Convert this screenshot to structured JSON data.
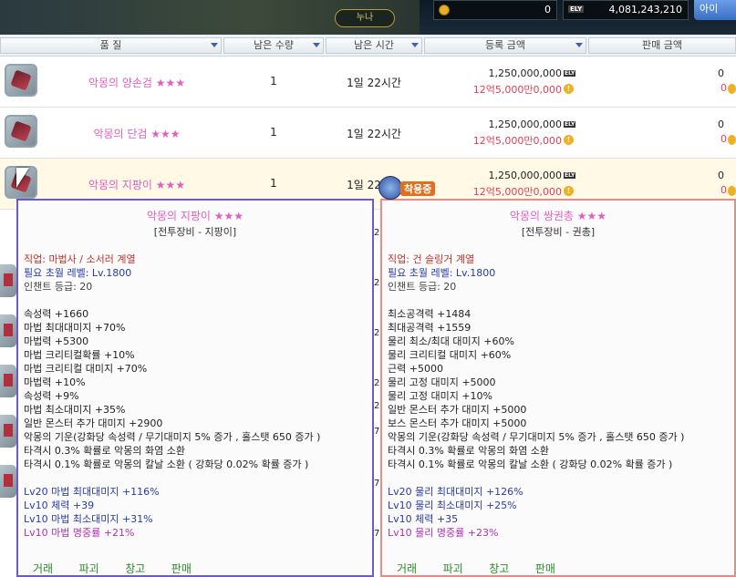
{
  "top": {
    "page_label": "누나",
    "gold_amount": "0",
    "ely_label": "ELY",
    "ely_amount": "4,081,243,210",
    "item_button": "아이"
  },
  "header": {
    "quality": "품 질",
    "remaining_qty": "남은 수량",
    "remaining_time": "남은 시간",
    "register_price": "등록 금액",
    "sell_price": "판매 금액"
  },
  "rows": [
    {
      "name": "악몽의 양손검",
      "stars": "★★★",
      "qty": "1",
      "time": "1일 22시간",
      "price_ely": "1,250,000,000",
      "price_won": "12억5,000만0,000",
      "sell_ely": "0",
      "sell_won": "0",
      "selected": false
    },
    {
      "name": "악몽의 단검",
      "stars": "★★★",
      "qty": "1",
      "time": "1일 22시간",
      "price_ely": "1,250,000,000",
      "price_won": "12억5,000만0,000",
      "sell_ely": "0",
      "sell_won": "0",
      "selected": false
    },
    {
      "name": "악몽의 지팡이",
      "stars": "★★★",
      "qty": "1",
      "time": "1일 22시간",
      "price_ely": "1,250,000,000",
      "price_won": "12억5,000만0,000",
      "sell_ely": "0",
      "sell_won": "0",
      "selected": true
    }
  ],
  "equipped_badge": "착용중",
  "tooltip_left": {
    "name": "악몽의 지팡이 ★★★",
    "category": "[전투장비 - 지팡이]",
    "job": "직업: 마법사 / 소서러 계열",
    "level": "필요 초월 레벨: Lv.1800",
    "enchant": "인챈트 등급: 20",
    "stats": [
      "속성력 +1660",
      "마법 최대대미지 +70%",
      "마법력 +5300",
      "마법 크리티컬확률 +10%",
      "마법 크리티컬 대미지 +70%",
      "마법력 +10%",
      "속성력 +9%",
      "마법 최소대미지 +35%",
      "일반 몬스터 추가 대미지 +2900"
    ],
    "specials": [
      "악몽의 기운(강화당 속성력 / 무기대미지 5% 증가 , 홀스탯 650 증가 )",
      "타격시 0.3% 확률로 악몽의 화염 소환",
      "타격시 0.1% 확률로 악몽의 칼날 소환 ( 강화당 0.02% 확률 증가 )"
    ],
    "levels": [
      "Lv20 마법 최대대미지 +116%",
      "Lv10 체력 +39",
      "Lv10 마법 최소대미지 +31%"
    ],
    "levels_purple": "Lv10 마법 명중률 +21%",
    "actions": [
      "거래",
      "파괴",
      "창고",
      "판매"
    ]
  },
  "tooltip_right": {
    "name": "악몽의 쌍권총 ★★★",
    "category": "[전투장비 - 권총]",
    "job": "직업: 건 슬링거 계열",
    "level": "필요 초월 레벨: Lv.1800",
    "enchant": "인챈트 등급: 20",
    "stats": [
      "최소공격력 +1484",
      "최대공격력 +1559",
      "물리 최소/최대 대미지 +60%",
      "물리 크리티컬 대미지 +60%",
      "근력 +5000",
      "물리 고정 대미지 +5000",
      "물리 고정 대미지 +10%",
      "일반 몬스터 추가 대미지 +5000",
      "보스 몬스터 추가 대미지 +5000"
    ],
    "specials": [
      "악몽의 기운(강화당 속성력 / 무기대미지 5% 증가 , 홀스탯 650 증가 )",
      "타격시 0.3% 확률로 악몽의 화염 소환",
      "타격시 0.1% 확률로 악몽의 칼날 소환 ( 강화당 0.02% 확률 증가 )"
    ],
    "levels": [
      "Lv20 물리 최대대미지 +126%",
      "Lv10 물리 최소대미지 +25%",
      "Lv10 체력 +35"
    ],
    "levels_purple": "Lv10 물리 명중률 +23%",
    "actions": [
      "거래",
      "파괴",
      "창고",
      "판매"
    ]
  },
  "side_numbers": [
    "2.",
    "2.",
    "2.",
    "2.",
    "2.",
    "7.",
    "7.",
    "7."
  ],
  "colors": {
    "accent": "#6a5acd",
    "compare_border": "#e88a8a",
    "item_pink": "#e060c0",
    "won_red": "#e0405a"
  }
}
